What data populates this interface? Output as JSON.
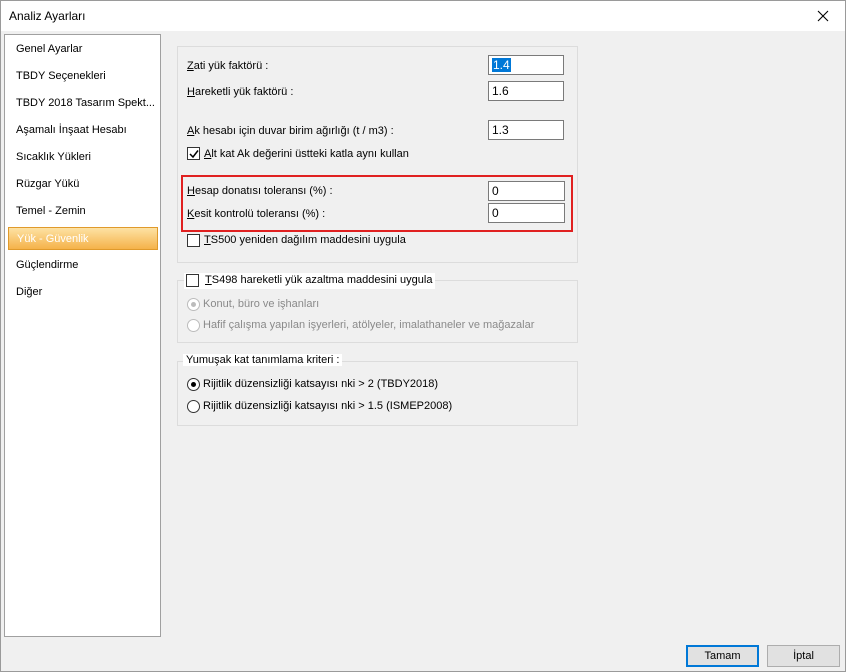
{
  "window": {
    "title": "Analiz Ayarları"
  },
  "sidebar": {
    "items": [
      {
        "label": "Genel Ayarlar"
      },
      {
        "label": "TBDY Seçenekleri"
      },
      {
        "label": "TBDY 2018 Tasarım Spekt..."
      },
      {
        "label": "Aşamalı İnşaat Hesabı"
      },
      {
        "label": "Sıcaklık Yükleri"
      },
      {
        "label": "Rüzgar Yükü"
      },
      {
        "label": "Temel - Zemin"
      },
      {
        "label": "Yük - Güvenlik"
      },
      {
        "label": "Güçlendirme"
      },
      {
        "label": "Diğer"
      }
    ],
    "active_index": 7
  },
  "form": {
    "dead_load_factor": {
      "label_u": "Z",
      "label_rest": "ati yük faktörü :",
      "value": "1.4"
    },
    "live_load_factor": {
      "label_u": "H",
      "label_rest": "areketli yük faktörü :",
      "value": "1.6"
    },
    "wall_weight": {
      "label_u": "A",
      "label_rest": "k hesabı için duvar birim ağırlığı (t / m3) :",
      "value": "1.3"
    },
    "lower_floor": {
      "label_u": "A",
      "label_rest": "lt kat  Ak değerini üstteki katla aynı kullan",
      "checked": true
    },
    "rebar_tolerance": {
      "label_u": "H",
      "label_rest": "esap donatısı toleransı (%) :",
      "value": "0"
    },
    "section_tolerance": {
      "label_u": "K",
      "label_rest": "esit kontrolü toleransı (%) :",
      "value": "0"
    },
    "ts500": {
      "label_u": "T",
      "label_rest": "S500 yeniden dağılım maddesini uygula",
      "checked": false
    }
  },
  "ts498": {
    "checkbox": {
      "label_u": "T",
      "label_rest": "S498 hareketli yük azaltma maddesini uygula",
      "checked": false
    },
    "options": [
      {
        "label": "Konut, büro ve işhanları",
        "selected": true
      },
      {
        "label": "Hafif çalışma yapılan işyerleri, atölyeler, imalathaneler ve mağazalar",
        "selected": false
      }
    ]
  },
  "soft_story": {
    "title": "Yumuşak kat tanımlama kriteri :",
    "options": [
      {
        "label": "Rijitlik düzensizliği katsayısı nki > 2 (TBDY2018)",
        "selected": true
      },
      {
        "label": "Rijitlik düzensizliği katsayısı nki > 1.5 (ISMEP2008)",
        "selected": false
      }
    ]
  },
  "buttons": {
    "ok": "Tamam",
    "cancel": "İptal"
  },
  "colors": {
    "highlight_border": "#e02020",
    "active_item": "#f5b24a",
    "selection": "#0078d7"
  }
}
